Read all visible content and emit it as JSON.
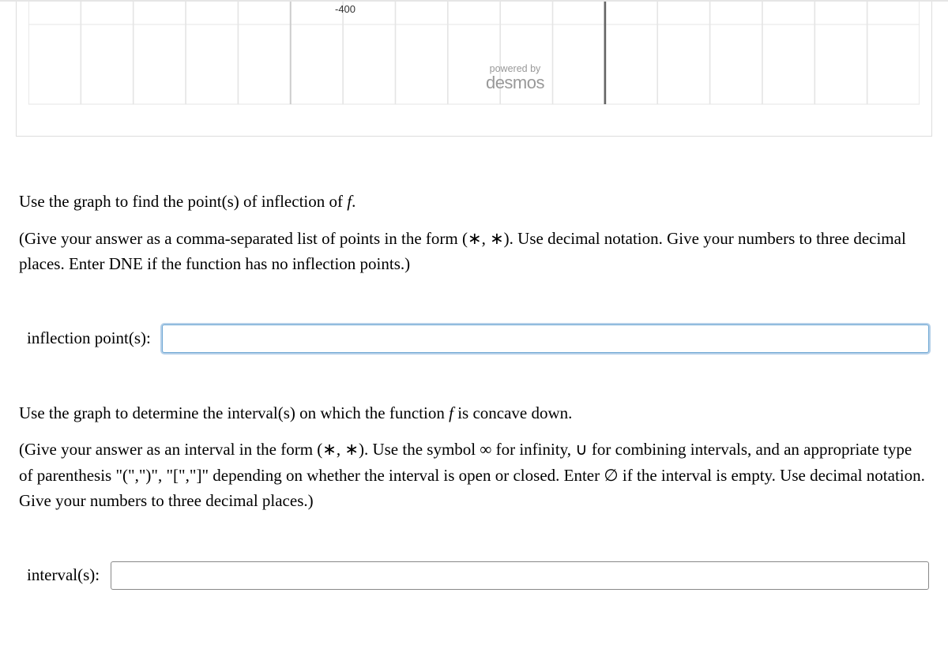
{
  "graph": {
    "axis_tick_label": "-400",
    "powered_by_text": "powered by",
    "brand": "desmos"
  },
  "q1": {
    "prompt_parts": [
      "Use the graph to find the point(s) of inflection of ",
      "f",
      "."
    ],
    "hint": "(Give your answer as a comma-separated list of points in the form (∗, ∗). Use decimal notation. Give your numbers to three decimal places. Enter DNE if the function has no inflection points.)",
    "label": "inflection point(s):",
    "value": ""
  },
  "q2": {
    "prompt_parts": [
      "Use the graph to determine the interval(s) on which the function ",
      "f",
      " is concave down."
    ],
    "hint": "(Give your answer as an interval in the form (∗, ∗). Use the symbol ∞ for infinity, ∪ for combining intervals, and an appropriate type of parenthesis \"(\",\")\", \"[\",\"]\" depending on whether the interval is open or closed. Enter ∅ if the interval is empty. Use decimal notation. Give your numbers to three decimal places.)",
    "label": "interval(s):",
    "value": ""
  }
}
